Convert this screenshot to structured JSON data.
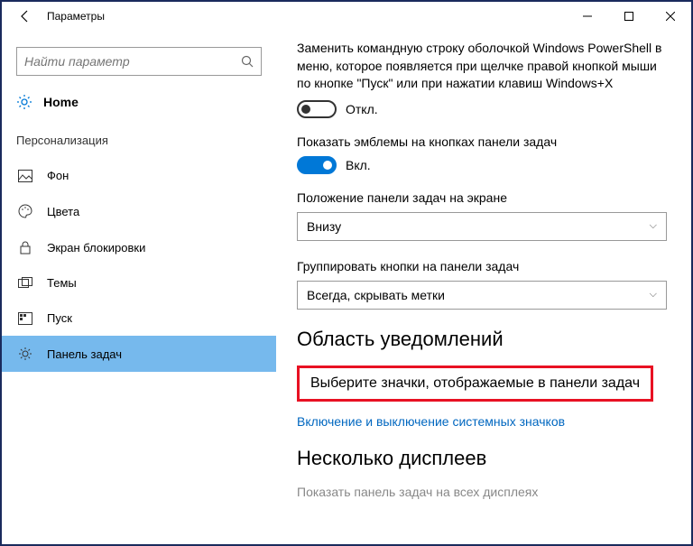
{
  "titlebar": {
    "title": "Параметры"
  },
  "search": {
    "placeholder": "Найти параметр"
  },
  "home": {
    "label": "Home"
  },
  "sidebar": {
    "section": "Персонализация",
    "items": [
      {
        "label": "Фон"
      },
      {
        "label": "Цвета"
      },
      {
        "label": "Экран блокировки"
      },
      {
        "label": "Темы"
      },
      {
        "label": "Пуск"
      },
      {
        "label": "Панель задач"
      }
    ]
  },
  "main": {
    "powershell_desc": "Заменить командную строку оболочкой Windows PowerShell в меню, которое появляется при щелчке правой кнопкой мыши по кнопке \"Пуск\" или при нажатии клавиш Windows+X",
    "toggle_off": "Откл.",
    "emblems_label": "Показать эмблемы на кнопках панели задач",
    "toggle_on": "Вкл.",
    "position_label": "Положение панели задач на экране",
    "position_value": "Внизу",
    "group_label": "Группировать кнопки на панели задач",
    "group_value": "Всегда, скрывать метки",
    "notif_heading": "Область уведомлений",
    "link1": "Выберите значки, отображаемые в панели задач",
    "link2": "Включение и выключение системных значков",
    "displays_heading": "Несколько дисплеев",
    "displays_faded": "Показать панель задач на всех дисплеях"
  }
}
